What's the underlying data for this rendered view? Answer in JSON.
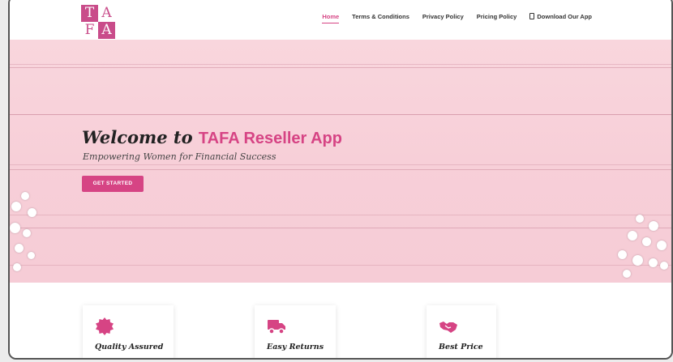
{
  "logo": {
    "letters": [
      "T",
      "A",
      "F",
      "A"
    ]
  },
  "nav": {
    "items": [
      {
        "label": "Home",
        "active": true
      },
      {
        "label": "Terms & Conditions",
        "active": false
      },
      {
        "label": "Privacy Policy",
        "active": false
      },
      {
        "label": "Pricing Policy",
        "active": false
      },
      {
        "label": "Download Our App",
        "active": false,
        "icon": "phone-icon"
      }
    ]
  },
  "hero": {
    "welcome_prefix": "Welcome to",
    "welcome_brand": "TAFA Reseller App",
    "tagline": "Empowering Women for Financial Success",
    "cta_label": "GET STARTED"
  },
  "features": [
    {
      "label": "Quality Assured",
      "icon": "badge-icon"
    },
    {
      "label": "Easy Returns",
      "icon": "truck-icon"
    },
    {
      "label": "Best Price",
      "icon": "handshake-icon"
    }
  ],
  "colors": {
    "accent": "#d64484",
    "hero_bg": "#f7cfd8",
    "text_dark": "#222222"
  }
}
